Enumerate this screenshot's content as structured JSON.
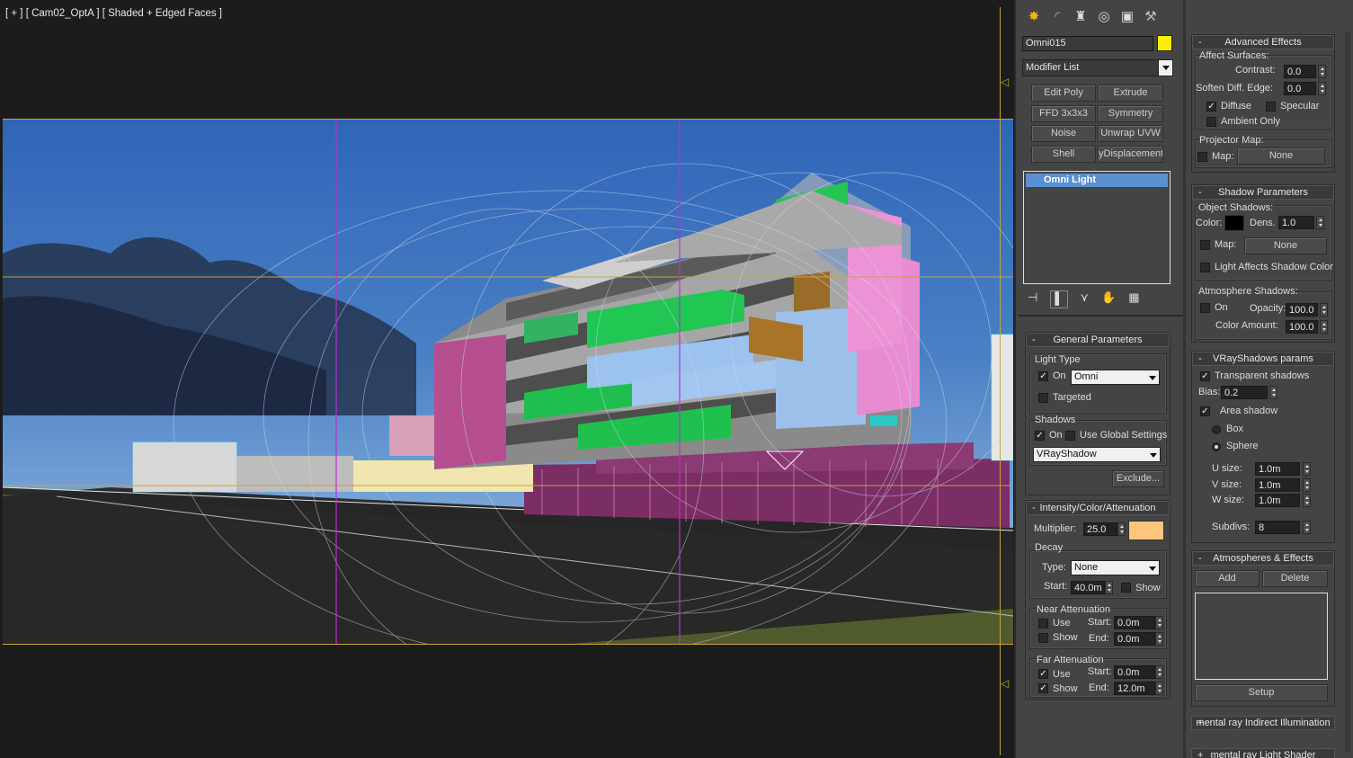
{
  "viewport": {
    "label": "[ + ] [ Cam02_OptA ] [ Shaded + Edged Faces ]"
  },
  "command_panel": {
    "tabs": [
      "create-icon",
      "modify-icon",
      "hierarchy-icon",
      "motion-icon",
      "display-icon",
      "utilities-icon"
    ],
    "object_name": "Omni015",
    "object_color": "#ffee00",
    "modifier_list": "Modifier List",
    "modifier_buttons": [
      "Edit Poly",
      "Extrude",
      "FFD 3x3x3",
      "Symmetry",
      "Noise",
      "Unwrap UVW",
      "Shell",
      "yDisplacement"
    ],
    "stack_item": "Omni Light"
  },
  "general": {
    "title": "General Parameters",
    "light_type_label": "Light Type",
    "on_label": "On",
    "light_type_value": "Omni",
    "targeted_label": "Targeted",
    "shadows_label": "Shadows",
    "shadows_on_label": "On",
    "use_global_label": "Use Global Settings",
    "shadow_type": "VRayShadow",
    "exclude_label": "Exclude..."
  },
  "intensity": {
    "title": "Intensity/Color/Attenuation",
    "multiplier_label": "Multiplier:",
    "multiplier": "25.0",
    "light_color": "#ffc57d",
    "decay_label": "Decay",
    "type_label": "Type:",
    "type_value": "None",
    "start_label": "Start:",
    "start_value": "40.0m",
    "show_label": "Show",
    "near_label": "Near Attenuation",
    "near_use": "Use",
    "near_show": "Show",
    "near_start_label": "Start:",
    "near_start": "0.0m",
    "near_end_label": "End:",
    "near_end": "0.0m",
    "far_label": "Far Attenuation",
    "far_use": "Use",
    "far_show": "Show",
    "far_start_label": "Start:",
    "far_start": "0.0m",
    "far_end_label": "End:",
    "far_end": "12.0m"
  },
  "advanced": {
    "title": "Advanced Effects",
    "affect_label": "Affect Surfaces:",
    "contrast_label": "Contrast:",
    "contrast": "0.0",
    "soften_label": "Soften Diff. Edge:",
    "soften": "0.0",
    "diffuse_label": "Diffuse",
    "specular_label": "Specular",
    "ambient_label": "Ambient Only",
    "projector_label": "Projector Map:",
    "map_label": "Map:",
    "map_value": "None"
  },
  "shadow_params": {
    "title": "Shadow Parameters",
    "object_shadows": "Object Shadows:",
    "color_label": "Color:",
    "dens_label": "Dens.",
    "dens": "1.0",
    "map_label": "Map:",
    "map_value": "None",
    "light_affects": "Light Affects Shadow Color",
    "atmosphere_label": "Atmosphere Shadows:",
    "on_label": "On",
    "opacity_label": "Opacity:",
    "opacity": "100.0",
    "color_amount_label": "Color Amount:",
    "color_amount": "100.0"
  },
  "vray": {
    "title": "VRayShadows params",
    "transparent": "Transparent shadows",
    "bias_label": "Bias:",
    "bias": "0.2",
    "area_shadow": "Area shadow",
    "box": "Box",
    "sphere": "Sphere",
    "u_label": "U size:",
    "u": "1.0m",
    "v_label": "V size:",
    "v": "1.0m",
    "w_label": "W size:",
    "w": "1.0m",
    "subdivs_label": "Subdivs:",
    "subdivs": "8"
  },
  "atmos": {
    "title": "Atmospheres & Effects",
    "add": "Add",
    "delete": "Delete",
    "setup": "Setup"
  },
  "extra_rollouts": [
    "mental ray Indirect Illumination",
    "mental ray Light Shader"
  ]
}
